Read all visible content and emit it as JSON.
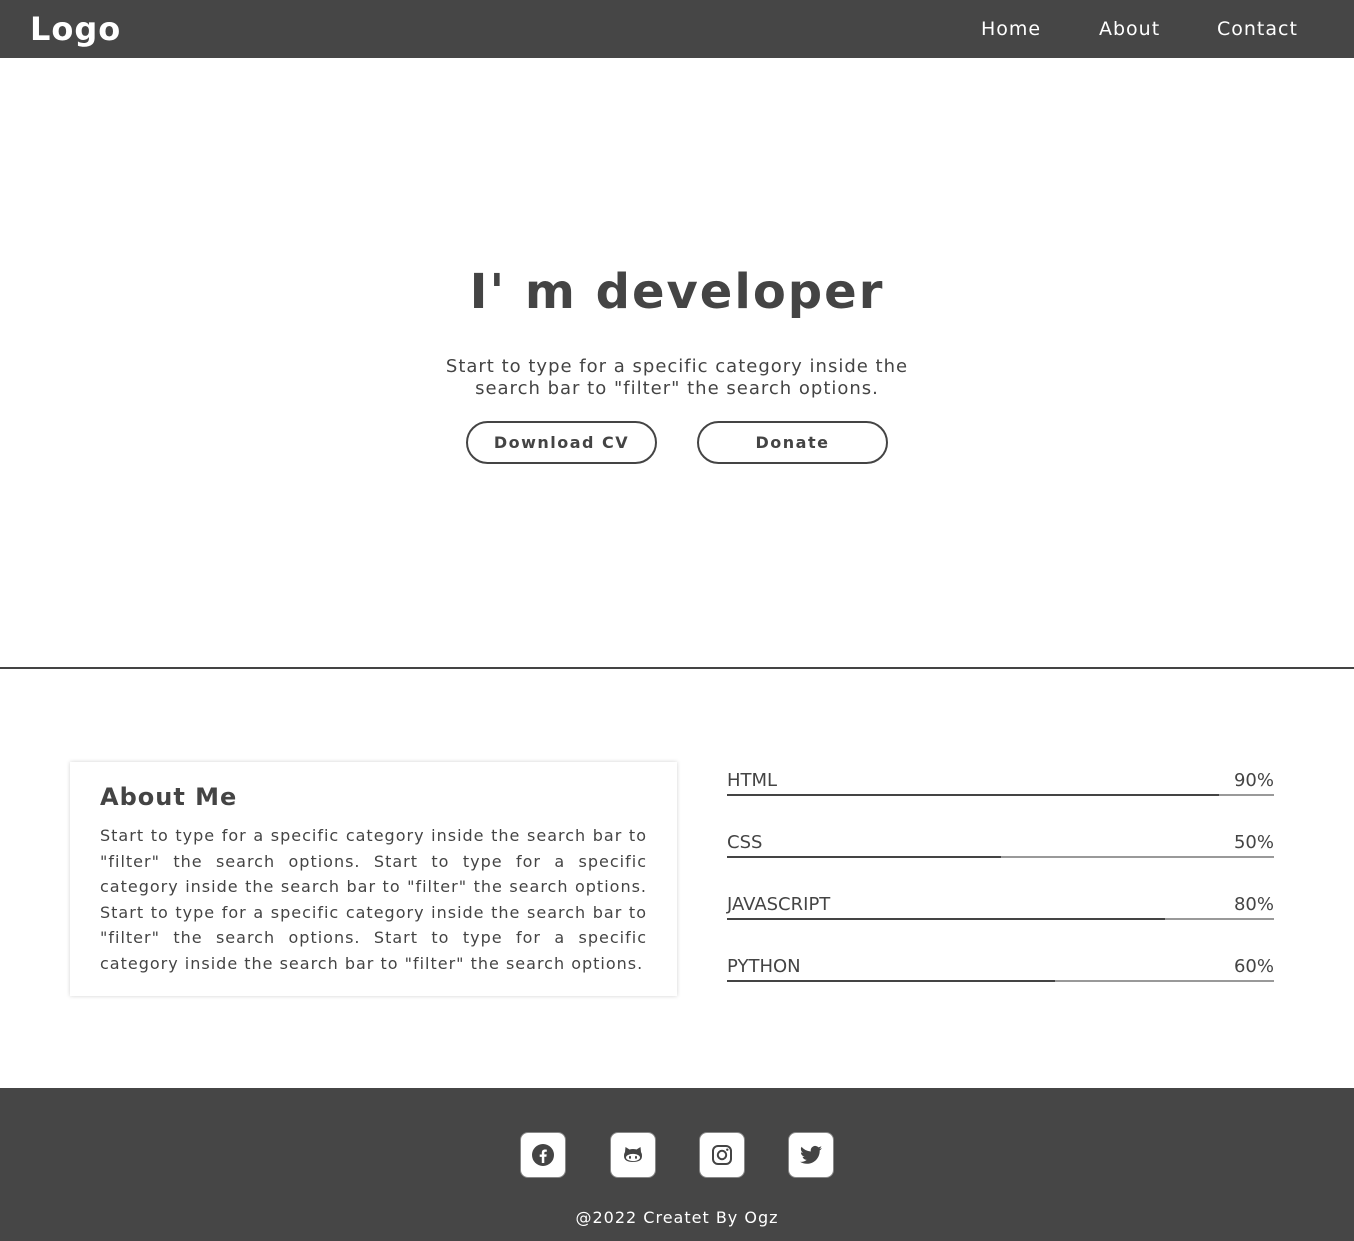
{
  "navbar": {
    "logo": "Logo",
    "links": [
      "Home",
      "About",
      "Contact"
    ]
  },
  "hero": {
    "title": "I' m developer",
    "subtitle": "Start to type for a specific category inside the search bar to \"filter\" the search options.",
    "buttons": {
      "download_cv": "Download CV",
      "donate": "Donate"
    }
  },
  "about": {
    "title": "About Me",
    "text": "Start to type for a specific category inside the search bar to \"filter\" the search options. Start to type for a specific category inside the search bar to \"filter\" the search options. Start to type for a specific category inside the search bar to \"filter\" the search options. Start to type for a specific category inside the search bar to \"filter\" the search options."
  },
  "skills": [
    {
      "name": "HTML",
      "percent_label": "90%",
      "level": 0.9
    },
    {
      "name": "CSS",
      "percent_label": "50%",
      "level": 0.5
    },
    {
      "name": "JAVASCRIPT",
      "percent_label": "80%",
      "level": 0.8
    },
    {
      "name": "PYTHON",
      "percent_label": "60%",
      "level": 0.6
    }
  ],
  "footer": {
    "social_icons": [
      "facebook-icon",
      "github-icon",
      "instagram-icon",
      "twitter-icon"
    ],
    "copyright": "@2022 Createt By Ogz"
  },
  "colors": {
    "header_bg": "#464646",
    "text": "#444444",
    "track": "#999999"
  }
}
